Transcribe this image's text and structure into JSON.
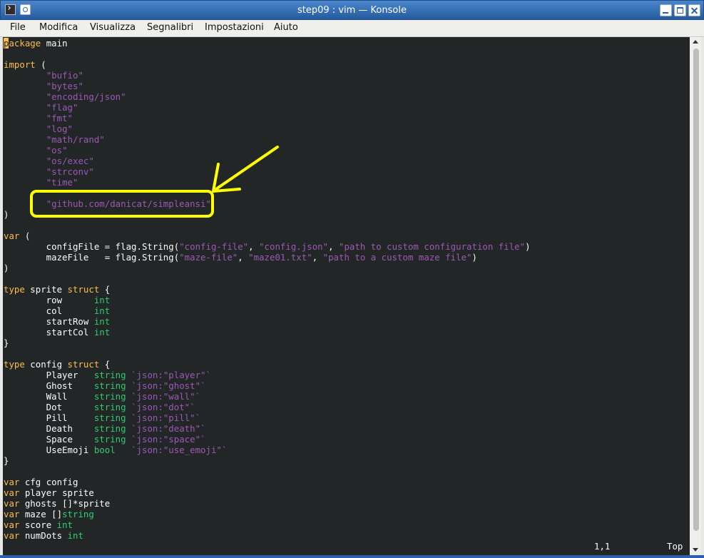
{
  "window": {
    "title": "step09 : vim — Konsole"
  },
  "menu": [
    "File",
    "Modifica",
    "Visualizza",
    "Segnalibri",
    "Impostazioni",
    "Aiuto"
  ],
  "colors": {
    "keyword": "#fdbc4b",
    "string": "#9b59b6",
    "type": "#2ecc71",
    "background": "#232627",
    "annotation": "#ffff00"
  },
  "code_lines": [
    [
      [
        "k",
        "p"
      ],
      [
        "k",
        "ackage"
      ],
      [
        "t",
        " main"
      ]
    ],
    [],
    [
      [
        "k",
        "import"
      ],
      [
        "t",
        " ("
      ]
    ],
    [
      [
        "t",
        "        "
      ],
      [
        "s",
        "\"bufio\""
      ]
    ],
    [
      [
        "t",
        "        "
      ],
      [
        "s",
        "\"bytes\""
      ]
    ],
    [
      [
        "t",
        "        "
      ],
      [
        "s",
        "\"encoding/json\""
      ]
    ],
    [
      [
        "t",
        "        "
      ],
      [
        "s",
        "\"flag\""
      ]
    ],
    [
      [
        "t",
        "        "
      ],
      [
        "s",
        "\"fmt\""
      ]
    ],
    [
      [
        "t",
        "        "
      ],
      [
        "s",
        "\"log\""
      ]
    ],
    [
      [
        "t",
        "        "
      ],
      [
        "s",
        "\"math/rand\""
      ]
    ],
    [
      [
        "t",
        "        "
      ],
      [
        "s",
        "\"os\""
      ]
    ],
    [
      [
        "t",
        "        "
      ],
      [
        "s",
        "\"os/exec\""
      ]
    ],
    [
      [
        "t",
        "        "
      ],
      [
        "s",
        "\"strconv\""
      ]
    ],
    [
      [
        "t",
        "        "
      ],
      [
        "s",
        "\"time\""
      ]
    ],
    [],
    [
      [
        "t",
        "        "
      ],
      [
        "s",
        "\"github.com/danicat/simpleansi\""
      ]
    ],
    [
      [
        "t",
        ")"
      ]
    ],
    [],
    [
      [
        "k",
        "var"
      ],
      [
        "t",
        " ("
      ]
    ],
    [
      [
        "t",
        "        configFile = flag.String("
      ],
      [
        "s",
        "\"config-file\""
      ],
      [
        "t",
        ", "
      ],
      [
        "s",
        "\"config.json\""
      ],
      [
        "t",
        ", "
      ],
      [
        "s",
        "\"path to custom configuration file\""
      ],
      [
        "t",
        ")"
      ]
    ],
    [
      [
        "t",
        "        mazeFile   = flag.String("
      ],
      [
        "s",
        "\"maze-file\""
      ],
      [
        "t",
        ", "
      ],
      [
        "s",
        "\"maze01.txt\""
      ],
      [
        "t",
        ", "
      ],
      [
        "s",
        "\"path to a custom maze file\""
      ],
      [
        "t",
        ")"
      ]
    ],
    [
      [
        "t",
        ")"
      ]
    ],
    [],
    [
      [
        "k",
        "type"
      ],
      [
        "t",
        " sprite "
      ],
      [
        "k",
        "struct"
      ],
      [
        "t",
        " {"
      ]
    ],
    [
      [
        "t",
        "        row      "
      ],
      [
        "y",
        "int"
      ]
    ],
    [
      [
        "t",
        "        col      "
      ],
      [
        "y",
        "int"
      ]
    ],
    [
      [
        "t",
        "        startRow "
      ],
      [
        "y",
        "int"
      ]
    ],
    [
      [
        "t",
        "        startCol "
      ],
      [
        "y",
        "int"
      ]
    ],
    [
      [
        "t",
        "}"
      ]
    ],
    [],
    [
      [
        "k",
        "type"
      ],
      [
        "t",
        " config "
      ],
      [
        "k",
        "struct"
      ],
      [
        "t",
        " {"
      ]
    ],
    [
      [
        "t",
        "        Player   "
      ],
      [
        "y",
        "string"
      ],
      [
        "t",
        " "
      ],
      [
        "s",
        "`json:\"player\"`"
      ]
    ],
    [
      [
        "t",
        "        Ghost    "
      ],
      [
        "y",
        "string"
      ],
      [
        "t",
        " "
      ],
      [
        "s",
        "`json:\"ghost\"`"
      ]
    ],
    [
      [
        "t",
        "        Wall     "
      ],
      [
        "y",
        "string"
      ],
      [
        "t",
        " "
      ],
      [
        "s",
        "`json:\"wall\"`"
      ]
    ],
    [
      [
        "t",
        "        Dot      "
      ],
      [
        "y",
        "string"
      ],
      [
        "t",
        " "
      ],
      [
        "s",
        "`json:\"dot\"`"
      ]
    ],
    [
      [
        "t",
        "        Pill     "
      ],
      [
        "y",
        "string"
      ],
      [
        "t",
        " "
      ],
      [
        "s",
        "`json:\"pill\"`"
      ]
    ],
    [
      [
        "t",
        "        Death    "
      ],
      [
        "y",
        "string"
      ],
      [
        "t",
        " "
      ],
      [
        "s",
        "`json:\"death\"`"
      ]
    ],
    [
      [
        "t",
        "        Space    "
      ],
      [
        "y",
        "string"
      ],
      [
        "t",
        " "
      ],
      [
        "s",
        "`json:\"space\"`"
      ]
    ],
    [
      [
        "t",
        "        UseEmoji "
      ],
      [
        "y",
        "bool"
      ],
      [
        "t",
        "   "
      ],
      [
        "s",
        "`json:\"use_emoji\"`"
      ]
    ],
    [
      [
        "t",
        "}"
      ]
    ],
    [],
    [
      [
        "k",
        "var"
      ],
      [
        "t",
        " cfg config"
      ]
    ],
    [
      [
        "k",
        "var"
      ],
      [
        "t",
        " player sprite"
      ]
    ],
    [
      [
        "k",
        "var"
      ],
      [
        "t",
        " ghosts []*sprite"
      ]
    ],
    [
      [
        "k",
        "var"
      ],
      [
        "t",
        " maze []"
      ],
      [
        "y",
        "string"
      ]
    ],
    [
      [
        "k",
        "var"
      ],
      [
        "t",
        " score "
      ],
      [
        "y",
        "int"
      ]
    ],
    [
      [
        "k",
        "var"
      ],
      [
        "t",
        " numDots "
      ],
      [
        "y",
        "int"
      ]
    ]
  ],
  "status": {
    "position": "1,1",
    "scroll": "Top"
  }
}
